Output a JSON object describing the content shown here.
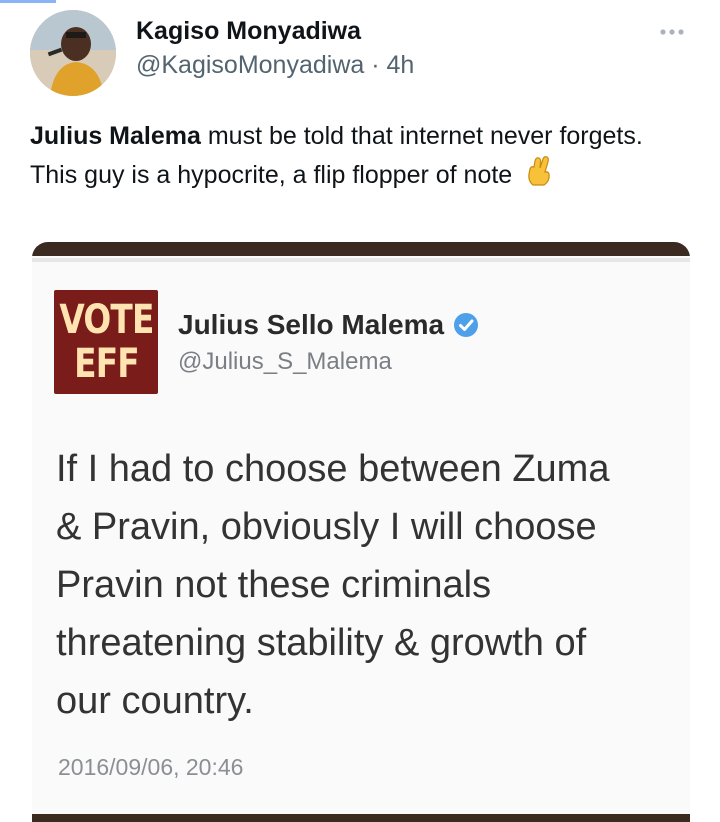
{
  "tweet": {
    "author_name": "Kagiso Monyadiwa",
    "author_handle": "@KagisoMonyadiwa",
    "separator": "·",
    "time": "4h",
    "text_mention": "Julius Malema",
    "text_body": " must be told that internet never forgets. This guy is a hypocrite, a flip flopper of note",
    "emoji_icon": "crossed-fingers-icon"
  },
  "embedded": {
    "logo_line1": "VOTE",
    "logo_line2": "EFF",
    "author_name": "Julius Sello Malema",
    "author_handle": "@Julius_S_Malema",
    "lines": [
      "If I had to choose between Zuma",
      "& Pravin, obviously I will choose",
      "Pravin not these criminals",
      "threatening stability & growth of",
      "our country."
    ],
    "timestamp": "2016/09/06, 20:46"
  },
  "colors": {
    "verified": "#4ea0e8",
    "logo_bg": "#7a1c1a",
    "secondary_text": "#536471"
  }
}
